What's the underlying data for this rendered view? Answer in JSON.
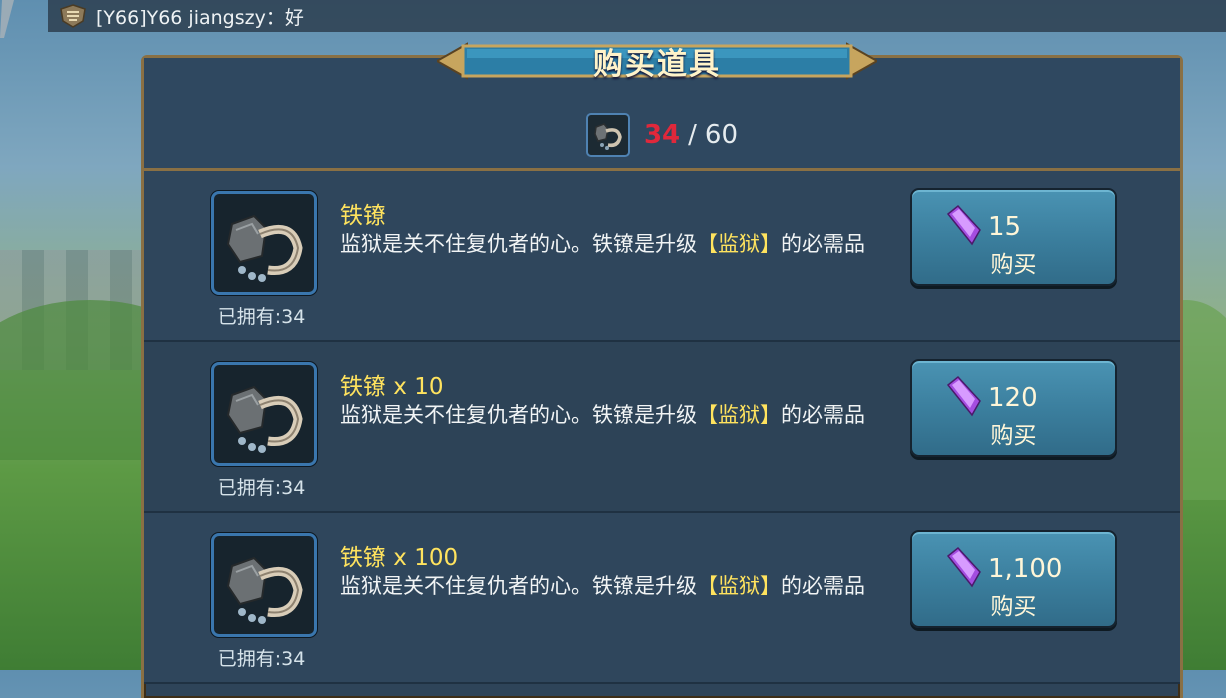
{
  "chat": {
    "message": "[Y66]Y66 jiangszy：好"
  },
  "dialog": {
    "title": "购买道具",
    "counter": {
      "owned": "34",
      "separator": "/",
      "max": "60"
    }
  },
  "items": [
    {
      "name": "铁镣",
      "desc_before": "监狱是关不住复仇者的心。铁镣是升级",
      "desc_highlight": "【监狱】",
      "desc_after": "的必需品",
      "owned": "已拥有:34",
      "price": "15",
      "buy_label": "购买"
    },
    {
      "name": "铁镣 x 10",
      "desc_before": "监狱是关不住复仇者的心。铁镣是升级",
      "desc_highlight": "【监狱】",
      "desc_after": "的必需品",
      "owned": "已拥有:34",
      "price": "120",
      "buy_label": "购买"
    },
    {
      "name": "铁镣 x 100",
      "desc_before": "监狱是关不住复仇者的心。铁镣是升级",
      "desc_highlight": "【监狱】",
      "desc_after": "的必需品",
      "owned": "已拥有:34",
      "price": "1,100",
      "buy_label": "购买"
    }
  ],
  "icons": {
    "item": "iron-shackles-icon",
    "currency": "purple-gem-icon",
    "guild_badge": "guild-badge-icon"
  },
  "colors": {
    "accent_yellow": "#ffe35e",
    "counter_red": "#e0283b",
    "button_blue": "#3a7d9c",
    "panel_bg": "#2e4459",
    "frame_gold": "#8a7044"
  }
}
